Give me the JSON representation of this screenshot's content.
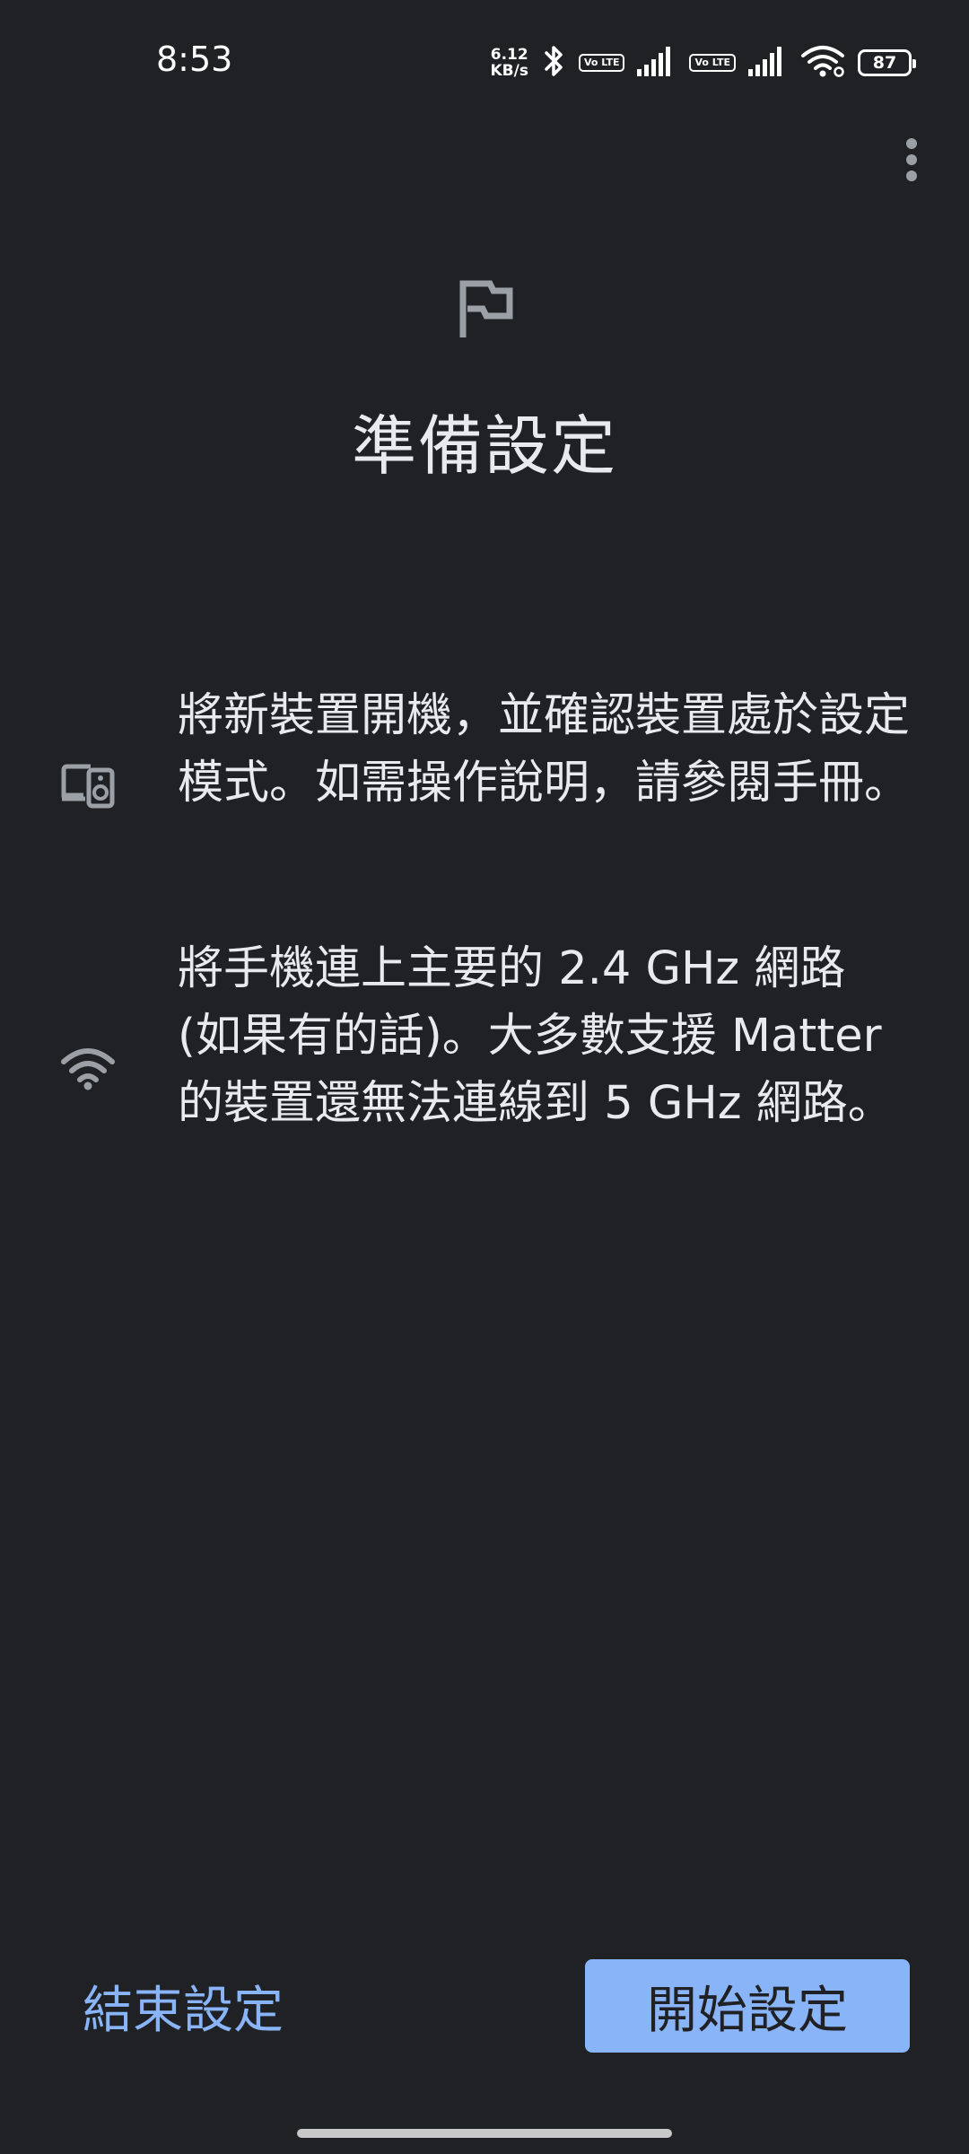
{
  "status_bar": {
    "time": "8:53",
    "net_speed_value": "6.12",
    "net_speed_unit": "KB/s",
    "volte_1": "Vo LTE",
    "volte_2": "Vo LTE",
    "battery": "87",
    "icons": [
      "bluetooth-icon",
      "signal-icon",
      "signal-icon",
      "wifi-icon",
      "battery-icon"
    ]
  },
  "header": {
    "menu_icon": "more-vert-icon",
    "flag_icon": "flag-icon",
    "title": "準備設定"
  },
  "instructions": [
    {
      "icon": "devices-icon",
      "text": "將新裝置開機，並確認裝置處於設定模式。如需操作說明，請參閱手冊。"
    },
    {
      "icon": "wifi-icon",
      "text": "將手機連上主要的 2.4 GHz 網路 (如果有的話)。大多數支援 Matter 的裝置還無法連線到 5 GHz 網路。"
    }
  ],
  "footer": {
    "end_label": "結束設定",
    "start_label": "開始設定"
  },
  "colors": {
    "background": "#202124",
    "text": "#e8eaed",
    "accent": "#8ab4f8",
    "icon": "#9aa0a6"
  }
}
